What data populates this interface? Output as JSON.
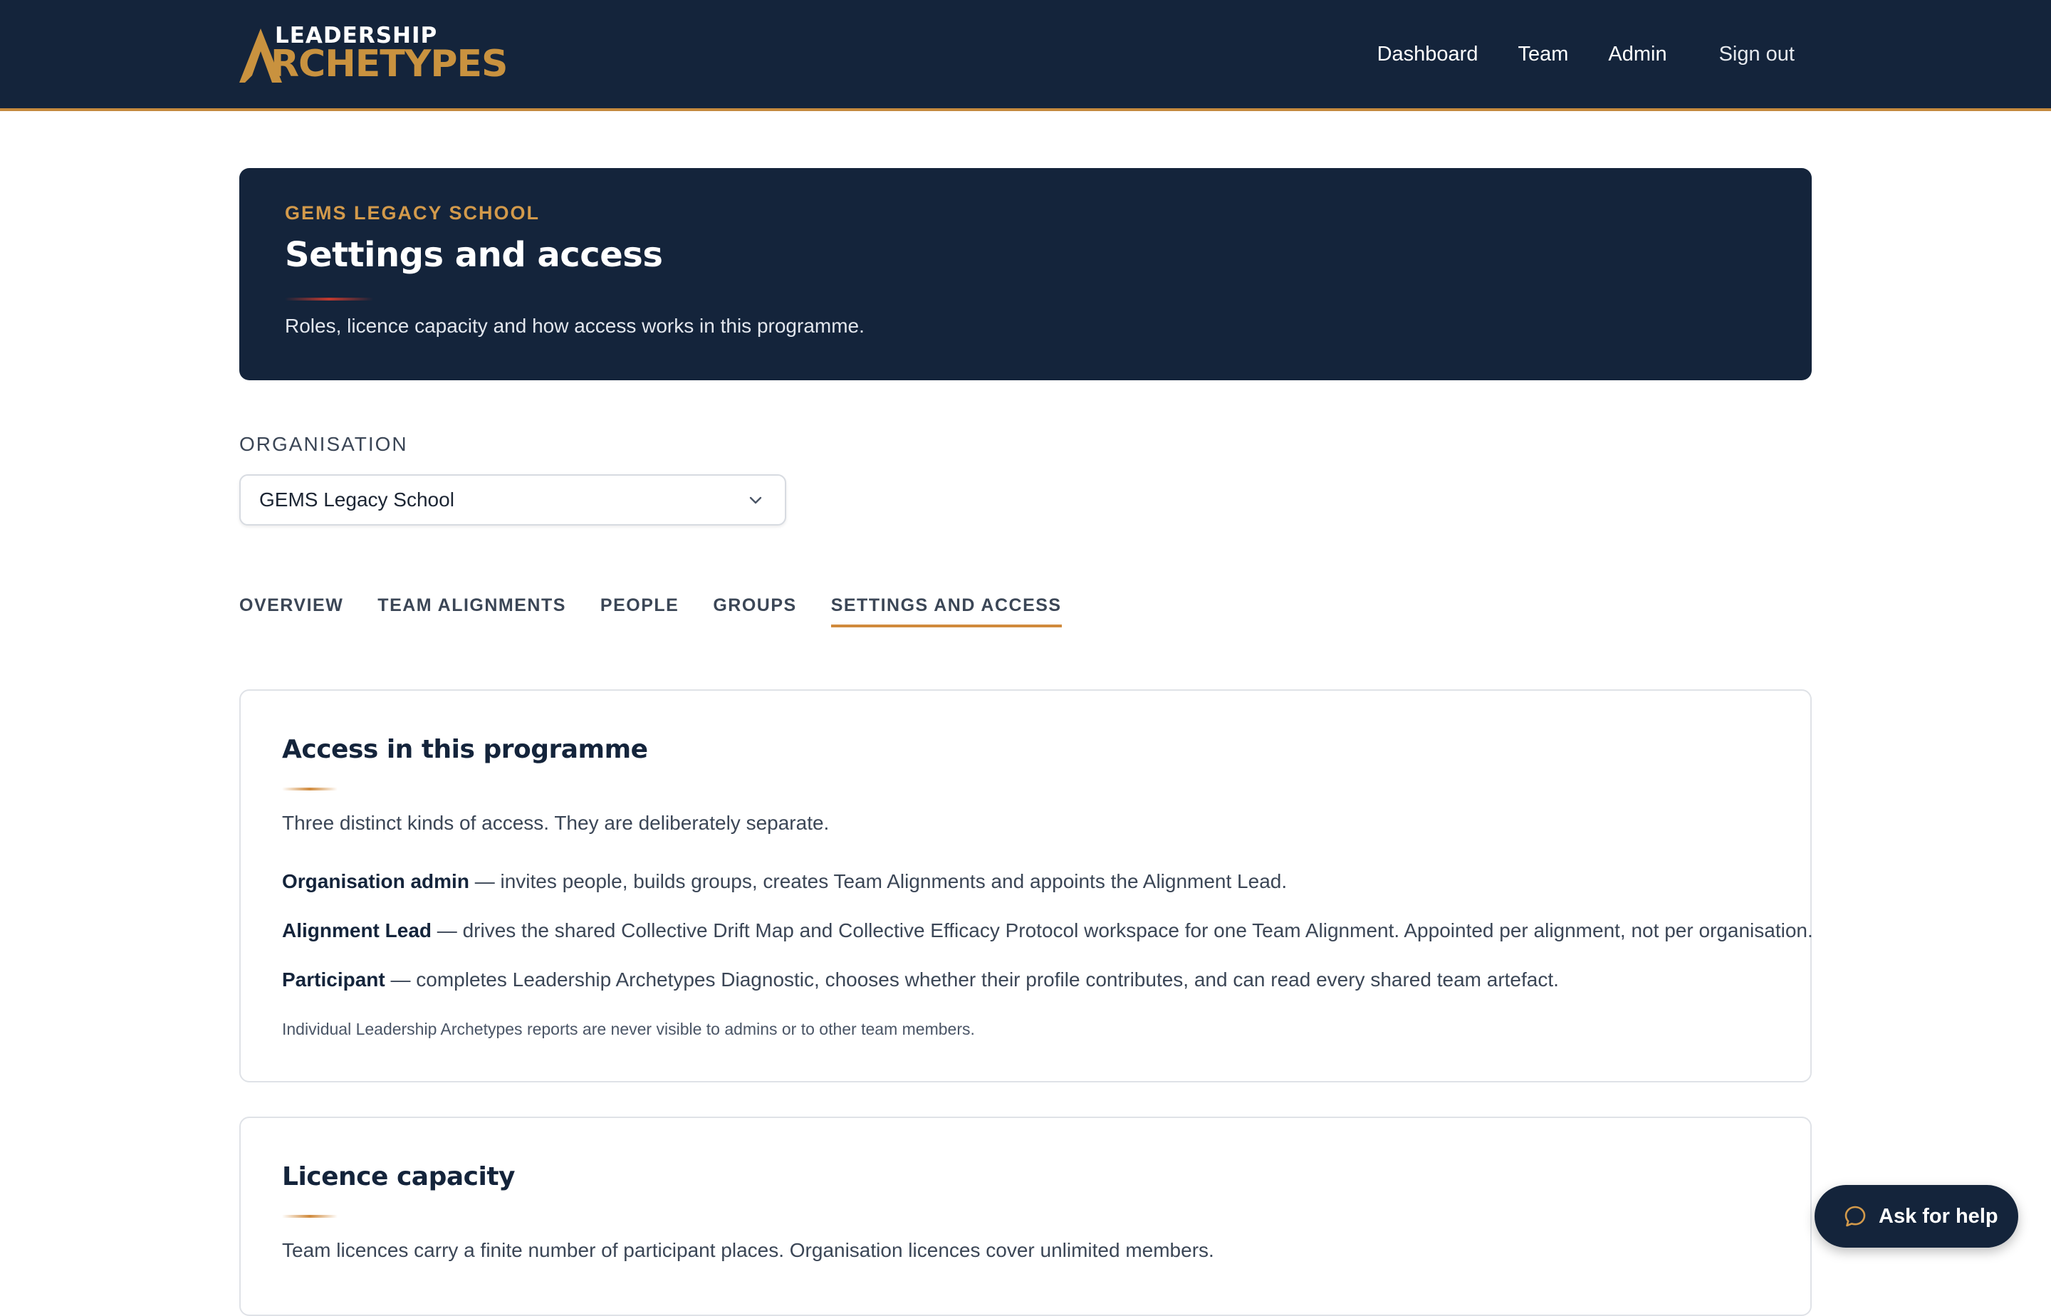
{
  "brand": {
    "line1": "LEADERSHIP",
    "line2": "RCHETYPES",
    "accent_color": "#c9923f",
    "navy": "#14243b"
  },
  "nav": {
    "items": [
      "Dashboard",
      "Team",
      "Admin"
    ],
    "sign_out": "Sign out"
  },
  "hero": {
    "eyebrow": "GEMS LEGACY SCHOOL",
    "title": "Settings and access",
    "subtitle": "Roles, licence capacity and how access works in this programme."
  },
  "organisation": {
    "label": "ORGANISATION",
    "selected": "GEMS Legacy School"
  },
  "tabs": [
    {
      "label": "OVERVIEW",
      "active": false
    },
    {
      "label": "TEAM ALIGNMENTS",
      "active": false
    },
    {
      "label": "PEOPLE",
      "active": false
    },
    {
      "label": "GROUPS",
      "active": false
    },
    {
      "label": "SETTINGS AND ACCESS",
      "active": true
    }
  ],
  "access_card": {
    "title": "Access in this programme",
    "intro": "Three distinct kinds of access. They are deliberately separate.",
    "roles": [
      {
        "name": "Organisation admin",
        "description": " — invites people, builds groups, creates Team Alignments and appoints the Alignment Lead."
      },
      {
        "name": "Alignment Lead",
        "description": " — drives the shared Collective Drift Map and Collective Efficacy Protocol workspace for one Team Alignment. Appointed per alignment, not per organisation."
      },
      {
        "name": "Participant",
        "description": " — completes Leadership Archetypes Diagnostic, chooses whether their profile contributes, and can read every shared team artefact."
      }
    ],
    "note": "Individual Leadership Archetypes reports are never visible to admins or to other team members."
  },
  "licence_card": {
    "title": "Licence capacity",
    "intro": "Team licences carry a finite number of participant places. Organisation licences cover unlimited members."
  },
  "help": {
    "label": "Ask for help",
    "icon": "chat-bubble-icon"
  }
}
